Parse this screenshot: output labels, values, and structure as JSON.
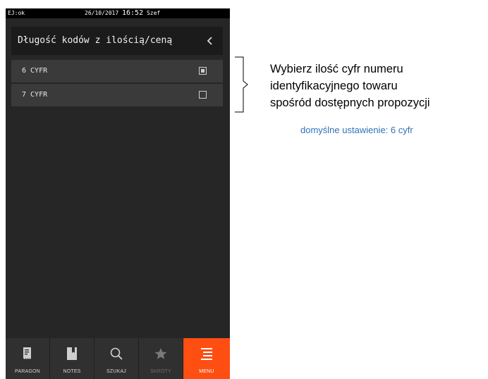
{
  "statusbar": {
    "ej": "EJ:ok",
    "date": "26/10/2017",
    "time": "16:52",
    "user": "Szef"
  },
  "header": {
    "title": "Długość kodów z ilością/ceną",
    "back_icon": "chevron-left-icon"
  },
  "options": [
    {
      "label": "6 CYFR",
      "selected": true
    },
    {
      "label": "7 CYFR",
      "selected": false
    }
  ],
  "bottom_nav": [
    {
      "label": "PARAGON",
      "icon": "receipt-icon",
      "state": "normal"
    },
    {
      "label": "NOTES",
      "icon": "bookmark-icon",
      "state": "normal"
    },
    {
      "label": "SZUKAJ",
      "icon": "search-icon",
      "state": "normal"
    },
    {
      "label": "SKRÓTY",
      "icon": "star-icon",
      "state": "disabled"
    },
    {
      "label": "MENU",
      "icon": "menu-icon",
      "state": "active"
    }
  ],
  "annotation": {
    "lines": [
      "Wybierz ilość cyfr numeru",
      "identyfikacyjnego towaru",
      "spośród dostępnych propozycji"
    ],
    "default_note": "domyślne ustawienie: 6 cyfr"
  },
  "colors": {
    "accent": "#ff4e12",
    "screen_bg": "#262626",
    "note_blue": "#2f73b6"
  }
}
